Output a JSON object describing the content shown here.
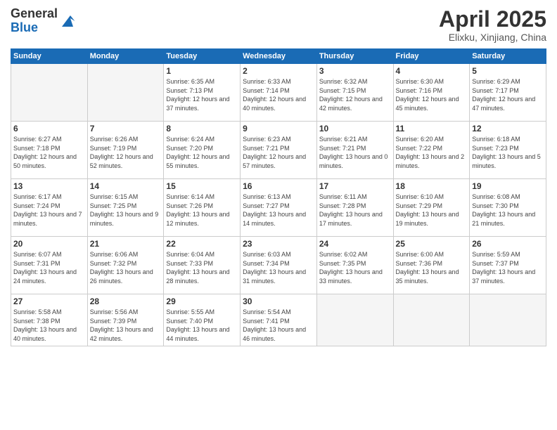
{
  "logo": {
    "general": "General",
    "blue": "Blue"
  },
  "header": {
    "month_year": "April 2025",
    "location": "Elixku, Xinjiang, China"
  },
  "weekdays": [
    "Sunday",
    "Monday",
    "Tuesday",
    "Wednesday",
    "Thursday",
    "Friday",
    "Saturday"
  ],
  "weeks": [
    [
      {
        "day": "",
        "empty": true
      },
      {
        "day": "",
        "empty": true
      },
      {
        "day": "1",
        "sunrise": "Sunrise: 6:35 AM",
        "sunset": "Sunset: 7:13 PM",
        "daylight": "Daylight: 12 hours and 37 minutes."
      },
      {
        "day": "2",
        "sunrise": "Sunrise: 6:33 AM",
        "sunset": "Sunset: 7:14 PM",
        "daylight": "Daylight: 12 hours and 40 minutes."
      },
      {
        "day": "3",
        "sunrise": "Sunrise: 6:32 AM",
        "sunset": "Sunset: 7:15 PM",
        "daylight": "Daylight: 12 hours and 42 minutes."
      },
      {
        "day": "4",
        "sunrise": "Sunrise: 6:30 AM",
        "sunset": "Sunset: 7:16 PM",
        "daylight": "Daylight: 12 hours and 45 minutes."
      },
      {
        "day": "5",
        "sunrise": "Sunrise: 6:29 AM",
        "sunset": "Sunset: 7:17 PM",
        "daylight": "Daylight: 12 hours and 47 minutes."
      }
    ],
    [
      {
        "day": "6",
        "sunrise": "Sunrise: 6:27 AM",
        "sunset": "Sunset: 7:18 PM",
        "daylight": "Daylight: 12 hours and 50 minutes."
      },
      {
        "day": "7",
        "sunrise": "Sunrise: 6:26 AM",
        "sunset": "Sunset: 7:19 PM",
        "daylight": "Daylight: 12 hours and 52 minutes."
      },
      {
        "day": "8",
        "sunrise": "Sunrise: 6:24 AM",
        "sunset": "Sunset: 7:20 PM",
        "daylight": "Daylight: 12 hours and 55 minutes."
      },
      {
        "day": "9",
        "sunrise": "Sunrise: 6:23 AM",
        "sunset": "Sunset: 7:21 PM",
        "daylight": "Daylight: 12 hours and 57 minutes."
      },
      {
        "day": "10",
        "sunrise": "Sunrise: 6:21 AM",
        "sunset": "Sunset: 7:21 PM",
        "daylight": "Daylight: 13 hours and 0 minutes."
      },
      {
        "day": "11",
        "sunrise": "Sunrise: 6:20 AM",
        "sunset": "Sunset: 7:22 PM",
        "daylight": "Daylight: 13 hours and 2 minutes."
      },
      {
        "day": "12",
        "sunrise": "Sunrise: 6:18 AM",
        "sunset": "Sunset: 7:23 PM",
        "daylight": "Daylight: 13 hours and 5 minutes."
      }
    ],
    [
      {
        "day": "13",
        "sunrise": "Sunrise: 6:17 AM",
        "sunset": "Sunset: 7:24 PM",
        "daylight": "Daylight: 13 hours and 7 minutes."
      },
      {
        "day": "14",
        "sunrise": "Sunrise: 6:15 AM",
        "sunset": "Sunset: 7:25 PM",
        "daylight": "Daylight: 13 hours and 9 minutes."
      },
      {
        "day": "15",
        "sunrise": "Sunrise: 6:14 AM",
        "sunset": "Sunset: 7:26 PM",
        "daylight": "Daylight: 13 hours and 12 minutes."
      },
      {
        "day": "16",
        "sunrise": "Sunrise: 6:13 AM",
        "sunset": "Sunset: 7:27 PM",
        "daylight": "Daylight: 13 hours and 14 minutes."
      },
      {
        "day": "17",
        "sunrise": "Sunrise: 6:11 AM",
        "sunset": "Sunset: 7:28 PM",
        "daylight": "Daylight: 13 hours and 17 minutes."
      },
      {
        "day": "18",
        "sunrise": "Sunrise: 6:10 AM",
        "sunset": "Sunset: 7:29 PM",
        "daylight": "Daylight: 13 hours and 19 minutes."
      },
      {
        "day": "19",
        "sunrise": "Sunrise: 6:08 AM",
        "sunset": "Sunset: 7:30 PM",
        "daylight": "Daylight: 13 hours and 21 minutes."
      }
    ],
    [
      {
        "day": "20",
        "sunrise": "Sunrise: 6:07 AM",
        "sunset": "Sunset: 7:31 PM",
        "daylight": "Daylight: 13 hours and 24 minutes."
      },
      {
        "day": "21",
        "sunrise": "Sunrise: 6:06 AM",
        "sunset": "Sunset: 7:32 PM",
        "daylight": "Daylight: 13 hours and 26 minutes."
      },
      {
        "day": "22",
        "sunrise": "Sunrise: 6:04 AM",
        "sunset": "Sunset: 7:33 PM",
        "daylight": "Daylight: 13 hours and 28 minutes."
      },
      {
        "day": "23",
        "sunrise": "Sunrise: 6:03 AM",
        "sunset": "Sunset: 7:34 PM",
        "daylight": "Daylight: 13 hours and 31 minutes."
      },
      {
        "day": "24",
        "sunrise": "Sunrise: 6:02 AM",
        "sunset": "Sunset: 7:35 PM",
        "daylight": "Daylight: 13 hours and 33 minutes."
      },
      {
        "day": "25",
        "sunrise": "Sunrise: 6:00 AM",
        "sunset": "Sunset: 7:36 PM",
        "daylight": "Daylight: 13 hours and 35 minutes."
      },
      {
        "day": "26",
        "sunrise": "Sunrise: 5:59 AM",
        "sunset": "Sunset: 7:37 PM",
        "daylight": "Daylight: 13 hours and 37 minutes."
      }
    ],
    [
      {
        "day": "27",
        "sunrise": "Sunrise: 5:58 AM",
        "sunset": "Sunset: 7:38 PM",
        "daylight": "Daylight: 13 hours and 40 minutes."
      },
      {
        "day": "28",
        "sunrise": "Sunrise: 5:56 AM",
        "sunset": "Sunset: 7:39 PM",
        "daylight": "Daylight: 13 hours and 42 minutes."
      },
      {
        "day": "29",
        "sunrise": "Sunrise: 5:55 AM",
        "sunset": "Sunset: 7:40 PM",
        "daylight": "Daylight: 13 hours and 44 minutes."
      },
      {
        "day": "30",
        "sunrise": "Sunrise: 5:54 AM",
        "sunset": "Sunset: 7:41 PM",
        "daylight": "Daylight: 13 hours and 46 minutes."
      },
      {
        "day": "",
        "empty": true
      },
      {
        "day": "",
        "empty": true
      },
      {
        "day": "",
        "empty": true
      }
    ]
  ]
}
